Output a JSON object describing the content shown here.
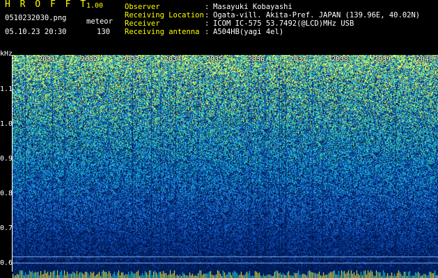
{
  "header": {
    "app_title": "H R O F F T",
    "app_version": "1.00",
    "file_name": "0510232030.png",
    "mode": "meteor",
    "datetime": "05.10.23 20:30",
    "count": "130"
  },
  "info": [
    {
      "key": "Observer",
      "value": "Masayuki Kobayashi"
    },
    {
      "key": "Receiving Location",
      "value": "Ogata-vill. Akita-Pref. JAPAN (139.96E, 40.02N)"
    },
    {
      "key": "Receiver",
      "value": "ICOM IC-575 53.7492(@LCD)MHz USB"
    },
    {
      "key": "Receiving antenna",
      "value": "A504HB(yagi 4el)"
    }
  ],
  "separator": ":",
  "spectrogram": {
    "y_unit": "kHz",
    "y_ticks": [
      "1.1",
      "1.0",
      "0.9",
      "0.8",
      "0.7",
      "0.6"
    ],
    "x_ticks": [
      "2031",
      "2032",
      "2033",
      "2034",
      "2035",
      "2036",
      "2037",
      "2038",
      "2039",
      "2040"
    ],
    "colors": {
      "low": "#001b55",
      "mid": "#1e6fd8",
      "high": "#19d7c8",
      "peak": "#ffff40"
    }
  }
}
